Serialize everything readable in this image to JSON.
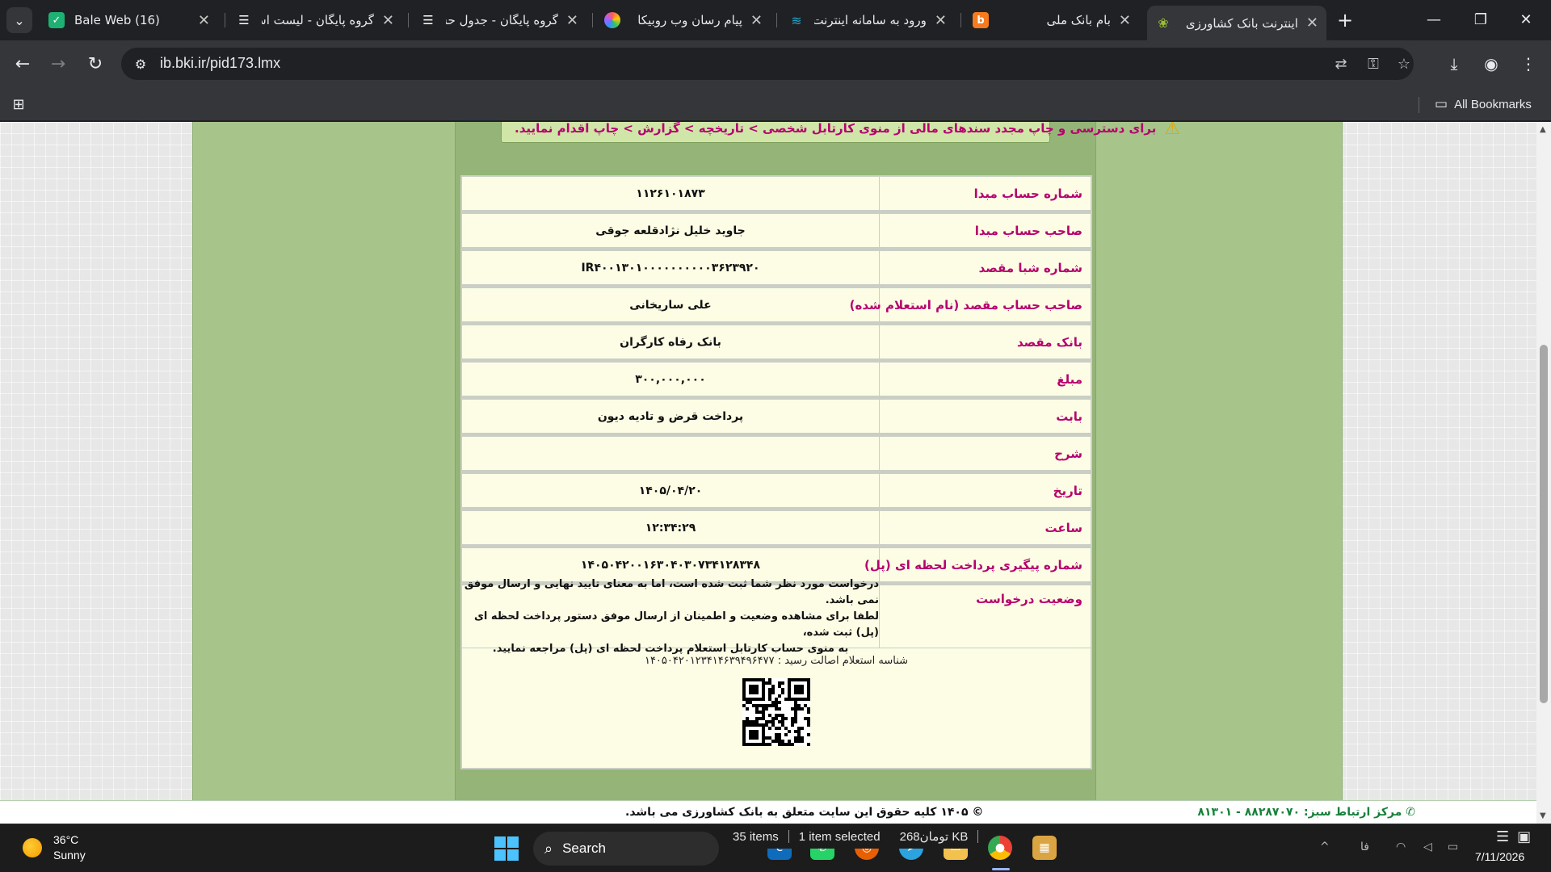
{
  "tabs": [
    {
      "title": "Bale Web (16)",
      "favicon": "bale-icon",
      "color": "#1db173"
    },
    {
      "title": "گروه پایگان - لیست اسناد",
      "favicon": "list-icon",
      "color": "#ffffff"
    },
    {
      "title": "گروه پایگان - جدول حساب",
      "favicon": "list-icon",
      "color": "#ffffff"
    },
    {
      "title": "پیام رسان وب روبیکا",
      "favicon": "rubika-icon",
      "color": "#ff5a5a"
    },
    {
      "title": "ورود به سامانه اینترنت",
      "favicon": "bank-icon",
      "color": "#1fa5c7"
    },
    {
      "title": "بام بانک ملی",
      "favicon": "bam-icon",
      "color": "#f47b20"
    },
    {
      "title": "اینترنت بانک کشاورزی",
      "favicon": "keshavarzi-icon",
      "color": "#9bbd3c",
      "active": true
    }
  ],
  "toolbar": {
    "url": "ib.bki.ir/pid173.lmx"
  },
  "bookmarks": {
    "all_label": "All Bookmarks"
  },
  "notice": {
    "text": "برای دسترسی و چاپ مجدد سندهای مالی از منوی کارتابل شخصی > تاریخچه > گزارش > چاپ اقدام نمایید."
  },
  "receipt": {
    "rows": [
      {
        "label": "شماره حساب مبدا",
        "value": "۱۱۲۶۱۰۱۸۷۳"
      },
      {
        "label": "صاحب حساب مبدا",
        "value": "جاوید خلیل نژادقلعه جوقی"
      },
      {
        "label": "شماره شبا مقصد",
        "value": "IR۴۰۰۱۳۰۱۰۰۰۰۰۰۰۰۰۰۳۶۲۳۹۲۰"
      },
      {
        "label": "صاحب حساب مقصد (نام استعلام شده)",
        "value": "علی ساریخانی"
      },
      {
        "label": "بانک مقصد",
        "value": "بانک رفاه کارگران"
      },
      {
        "label": "مبلغ",
        "value": "۳۰۰,۰۰۰,۰۰۰"
      },
      {
        "label": "بابت",
        "value": "پرداخت قرض و تادیه دیون"
      },
      {
        "label": "شرح",
        "value": ""
      },
      {
        "label": "تاریخ",
        "value": "۱۴۰۵/۰۴/۲۰"
      },
      {
        "label": "ساعت",
        "value": "۱۲:۳۴:۲۹"
      },
      {
        "label": "شماره پیگیری پرداخت لحظه ای (پل)",
        "value": "۱۴۰۵۰۴۲۰۰۱۶۳۰۴۰۳۰۷۳۴۱۲۸۳۴۸"
      }
    ],
    "status": {
      "label": "وضعیت درخواست",
      "lines": [
        "درخواست مورد نظر شما ثبت شده است، اما به معنای تایید نهایی و ارسال موفق نمی باشد.",
        "لطفا برای مشاهده وضعیت و اطمینان از ارسال موفق دستور پرداخت لحظه ای (پل) ثبت شده،",
        "به منوی حساب کارتابل استعلام پرداخت لحظه ای (پل) مراجعه نمایید."
      ]
    },
    "verification": {
      "text": "شناسه استعلام اصالت رسید : ۱۴۰۵۰۴۲۰۱۲۳۴۱۴۶۳۹۴۹۶۴۷۷"
    }
  },
  "footer": {
    "copyright": "© ۱۴۰۵ کلیه حقوق این سایت متعلق به بانک کشاورزی می باشد.",
    "contact": "مرکز ارتباط سبز: ۸۸۲۸۷۰۷۰ - ۸۱۳۰۱"
  },
  "taskbar": {
    "weather_temp": "36°C",
    "weather_desc": "Sunny",
    "search_label": "Search",
    "explorer_items": "35 items",
    "explorer_selected": "1 item selected",
    "explorer_size": "2تومان68 KB",
    "date": "7/11/2026"
  },
  "colors": {
    "label": "#b5006e",
    "page_green": "#a7c58a",
    "receipt_bg": "#fdfde5"
  }
}
